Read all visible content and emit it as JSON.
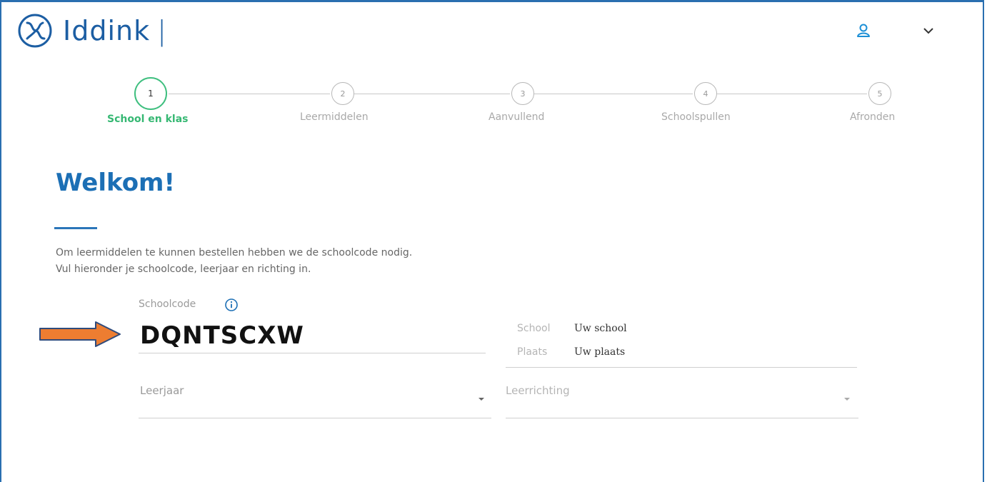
{
  "header": {
    "brand": "Iddink",
    "separator": "|",
    "colors": {
      "brand": "#1c5ea3",
      "accent_green": "#36b873",
      "heading_blue": "#1c6fb5",
      "arrow_orange": "#ed7d31"
    },
    "icons": [
      "user-icon",
      "chevron-down-icon"
    ]
  },
  "steps": [
    {
      "number": "1",
      "label": "School en klas"
    },
    {
      "number": "2",
      "label": "Leermiddelen"
    },
    {
      "number": "3",
      "label": "Aanvullend"
    },
    {
      "number": "4",
      "label": "Schoolspullen"
    },
    {
      "number": "5",
      "label": "Afronden"
    }
  ],
  "main": {
    "title": "Welkom!",
    "intro_line1": "Om leermiddelen te kunnen bestellen hebben we de schoolcode nodig.",
    "intro_line2": "Vul hieronder je schoolcode, leerjaar en richting in.",
    "schoolcode": {
      "label": "Schoolcode",
      "value": "DQNTSCXW"
    },
    "school": {
      "key": "School",
      "value": "Uw school"
    },
    "plaats": {
      "key": "Plaats",
      "value": "Uw plaats"
    },
    "leerjaar": {
      "placeholder": "Leerjaar"
    },
    "leerrichting": {
      "placeholder": "Leerrichting"
    }
  }
}
